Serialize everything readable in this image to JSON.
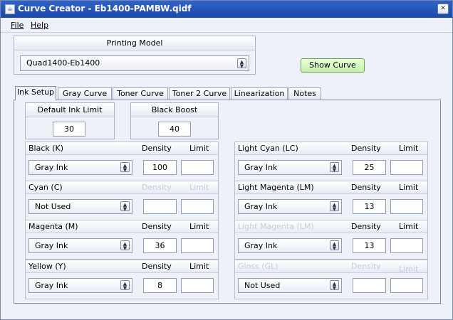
{
  "window": {
    "title": "Curve Creator - Eb1400-PAMBW.qidf",
    "close_glyph": "✕",
    "icon_glyph": "☕"
  },
  "menu": {
    "file": "File",
    "help": "Help"
  },
  "printing_model": {
    "header": "Printing Model",
    "selected": "Quad1400-Eb1400"
  },
  "show_curve_label": "Show Curve",
  "tabs": [
    "Ink Setup",
    "Gray Curve",
    "Toner Curve",
    "Toner 2 Curve",
    "Linearization",
    "Notes"
  ],
  "default_ink_limit": {
    "label": "Default Ink Limit",
    "value": "30"
  },
  "black_boost": {
    "label": "Black Boost",
    "value": "40"
  },
  "col_labels": {
    "density": "Density",
    "limit": "Limit"
  },
  "inks_left": [
    {
      "name": "Black (K)",
      "type": "Gray Ink",
      "density": "100",
      "limit": "",
      "enabled": true
    },
    {
      "name": "Cyan (C)",
      "type": "Not Used",
      "density": "",
      "limit": "",
      "enabled": false
    },
    {
      "name": "Magenta (M)",
      "type": "Gray Ink",
      "density": "36",
      "limit": "",
      "enabled": true
    },
    {
      "name": "Yellow (Y)",
      "type": "Gray Ink",
      "density": "8",
      "limit": "",
      "enabled": true
    }
  ],
  "inks_right": [
    {
      "name": "Light Cyan (LC)",
      "type": "Gray Ink",
      "density": "25",
      "limit": "",
      "enabled": true
    },
    {
      "name": "Light Magenta (LM)",
      "type": "Gray Ink",
      "density": "13",
      "limit": "",
      "enabled": true
    },
    {
      "name": "Light Magenta (LM)",
      "type": "Gray Ink",
      "density": "13",
      "limit": "",
      "enabled": false
    },
    {
      "name": "Gloss (GL)",
      "type": "Not Used",
      "density": "",
      "limit": "",
      "enabled": false
    }
  ]
}
